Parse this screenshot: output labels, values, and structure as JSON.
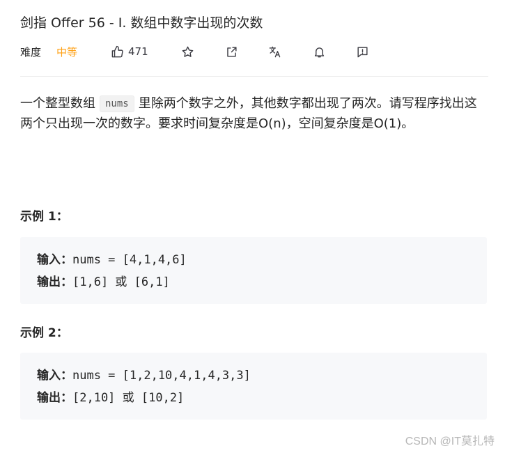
{
  "problem": {
    "title": "剑指 Offer 56 - I. 数组中数字出现的次数",
    "difficulty_label": "难度",
    "difficulty_value": "中等",
    "like_count": "471",
    "description_part1": "一个整型数组",
    "description_code": "nums",
    "description_part2": "里除两个数字之外，其他数字都出现了两次。请写程序找出这两个只出现一次的数字。要求时间复杂度是O(n)，空间复杂度是O(1)。"
  },
  "examples": [
    {
      "title": "示例 1：",
      "input_label": "输入：",
      "input_value": "nums = [4,1,4,6]",
      "output_label": "输出：",
      "output_value": "[1,6] 或 [6,1]"
    },
    {
      "title": "示例 2：",
      "input_label": "输入：",
      "input_value": "nums = [1,2,10,4,1,4,3,3]",
      "output_label": "输出：",
      "output_value": "[2,10] 或 [10,2]"
    }
  ],
  "watermark": "CSDN @IT莫扎特",
  "colors": {
    "difficulty_medium": "#ffa116",
    "code_block_bg": "#f7f8fa",
    "text": "#262626"
  },
  "icons": [
    "thumbs-up-icon",
    "star-icon",
    "share-icon",
    "translate-icon",
    "bell-icon",
    "feedback-icon"
  ]
}
